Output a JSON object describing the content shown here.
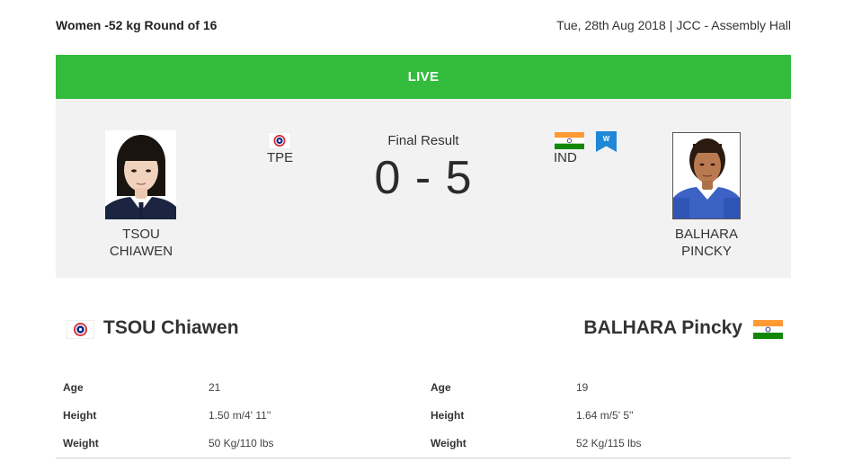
{
  "header": {
    "event": "Women -52 kg Round of 16",
    "date": "Tue, 28th Aug 2018",
    "separator": "|",
    "venue": "JCC - Assembly Hall"
  },
  "live": {
    "label": "LIVE"
  },
  "score_panel": {
    "status": "Final Result",
    "score": "0 - 5",
    "left": {
      "first_line": "TSOU",
      "second_line": "CHIAWEN",
      "country": "TPE",
      "flag": "chinese-taipei-flag-icon"
    },
    "right": {
      "first_line": "BALHARA",
      "second_line": "PINCKY",
      "country": "IND",
      "flag": "india-flag-icon",
      "badge": "W"
    }
  },
  "details": {
    "left": {
      "name": "TSOU Chiawen",
      "age_label": "Age",
      "age": "21",
      "height_label": "Height",
      "height": "1.50 m/4' 11''",
      "weight_label": "Weight",
      "weight": "50 Kg/110 lbs"
    },
    "right": {
      "name": "BALHARA Pincky",
      "age_label": "Age",
      "age": "19",
      "height_label": "Height",
      "height": "1.64 m/5' 5''",
      "weight_label": "Weight",
      "weight": "52 Kg/115 lbs"
    }
  },
  "colors": {
    "live_green": "#33bb3c",
    "panel_bg": "#f2f2f2",
    "winner_badge": "#1e88d6",
    "india_saffron": "#ff9933",
    "india_green": "#138808",
    "tpe_blue": "#0b2d8a",
    "tpe_red": "#d72b34"
  }
}
